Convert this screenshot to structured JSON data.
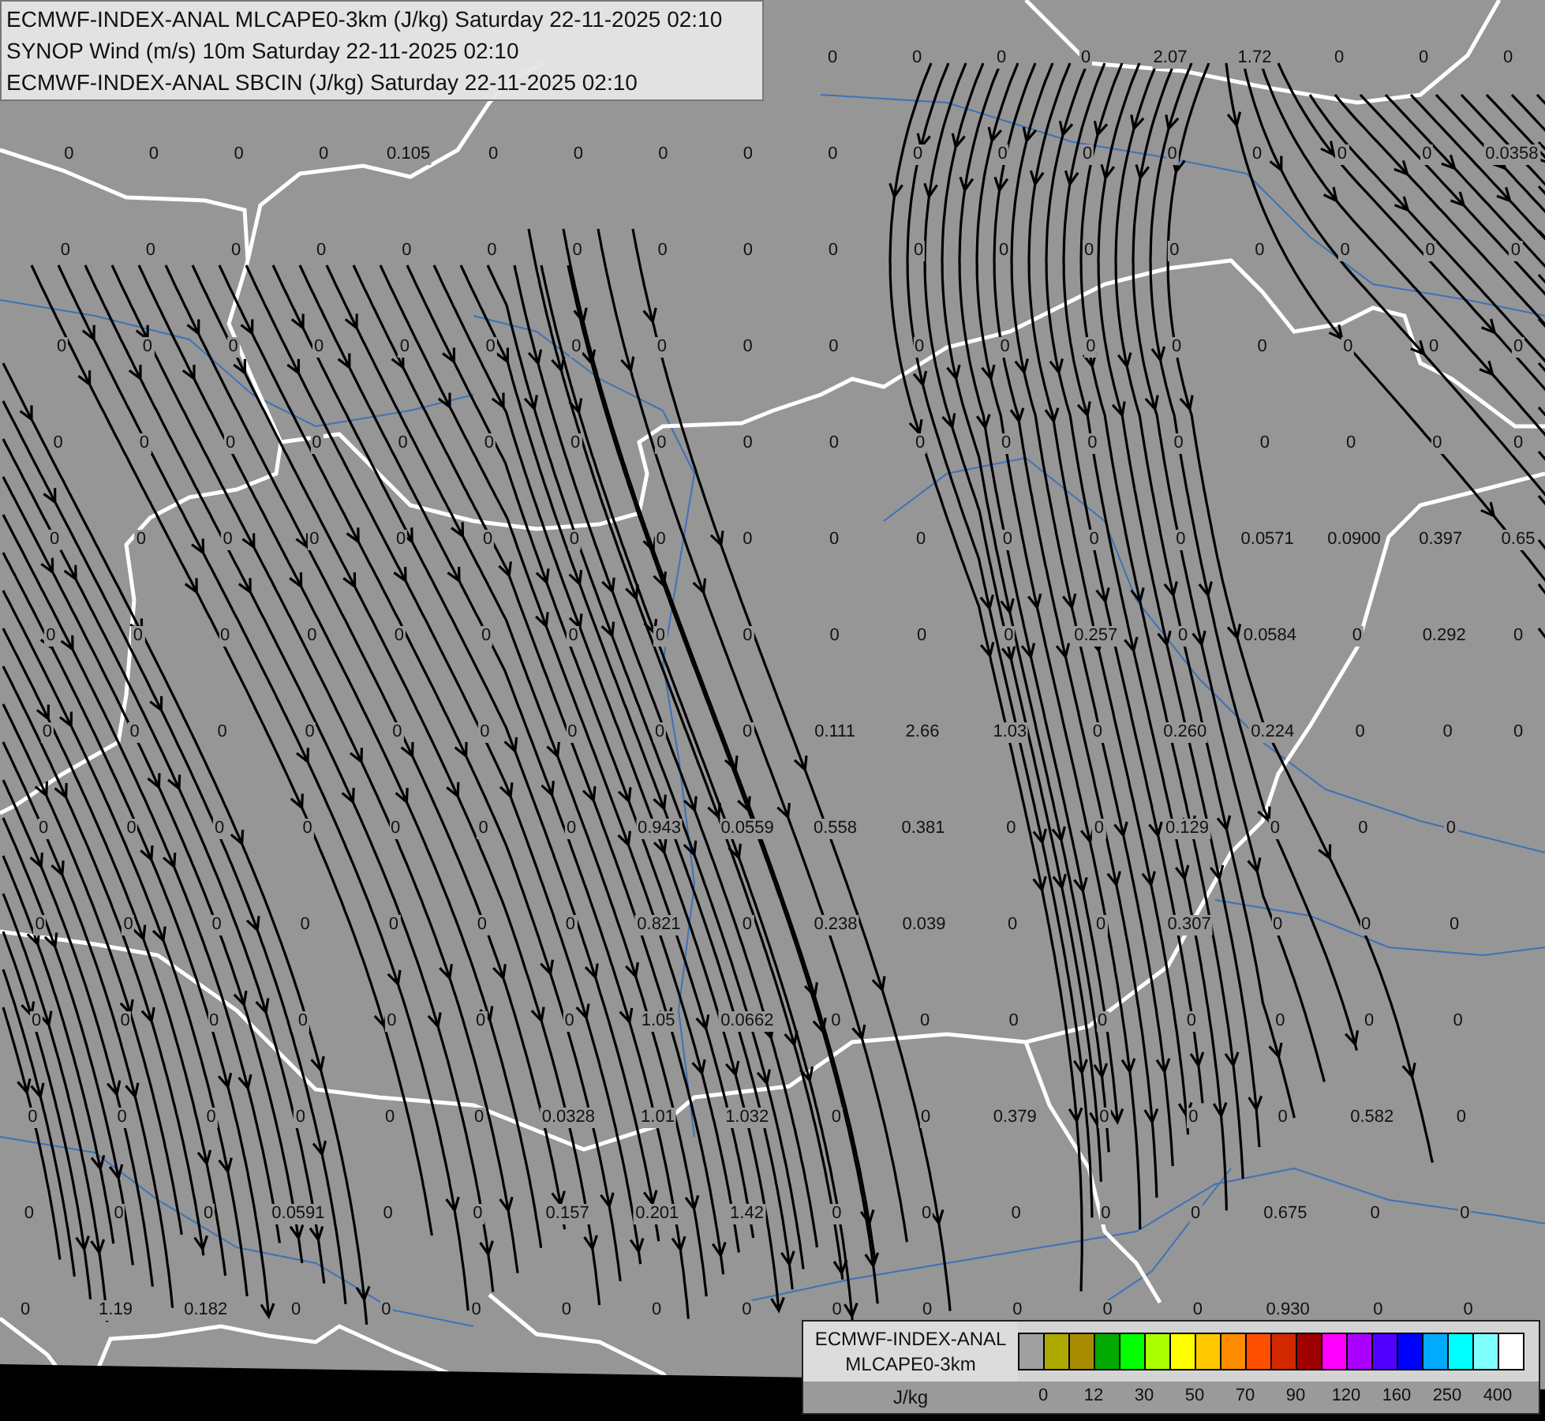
{
  "header": {
    "lines": [
      "ECMWF-INDEX-ANAL MLCAPE0-3km (J/kg) Saturday 22-11-2025 02:10",
      "SYNOP Wind (m/s) 10m Saturday 22-11-2025 02:10",
      "ECMWF-INDEX-ANAL SBCIN (J/kg) Saturday 22-11-2025 02:10"
    ]
  },
  "map": {
    "grid_rows": [
      {
        "kind": "trailing",
        "values": [
          "0",
          "0",
          "0",
          "0",
          "2.07",
          "1.72",
          "0",
          "0",
          "0"
        ]
      },
      {
        "kind": "full",
        "values": [
          "0",
          "0",
          "0",
          "0",
          "0.105",
          "0",
          "0",
          "0",
          "0",
          "0",
          "0",
          "0",
          "0",
          "0",
          "0",
          "0",
          "0",
          "0.0358"
        ]
      },
      {
        "kind": "full",
        "values": [
          "0",
          "0",
          "0",
          "0",
          "0",
          "0",
          "0",
          "0",
          "0",
          "0",
          "0",
          "0",
          "0",
          "0",
          "0",
          "0",
          "0",
          "0"
        ]
      },
      {
        "kind": "full",
        "values": [
          "0",
          "0",
          "0",
          "0",
          "0",
          "0",
          "0",
          "0",
          "0",
          "0",
          "0",
          "0",
          "0",
          "0",
          "0",
          "0",
          "0",
          "0"
        ]
      },
      {
        "kind": "full",
        "values": [
          "0",
          "0",
          "0",
          "0",
          "0",
          "0",
          "0",
          "0",
          "0",
          "0",
          "0",
          "0",
          "0",
          "0",
          "0",
          "0",
          "0",
          "0"
        ]
      },
      {
        "kind": "full",
        "values": [
          "0",
          "0",
          "0",
          "0",
          "0",
          "0",
          "0",
          "0",
          "0",
          "0",
          "0",
          "0",
          "0",
          "0",
          "0.0571",
          "0.0900",
          "0.397",
          "0.65"
        ]
      },
      {
        "kind": "full",
        "values": [
          "0",
          "0",
          "0",
          "0",
          "0",
          "0",
          "0",
          "0",
          "0",
          "0",
          "0",
          "0",
          "0.257",
          "0",
          "0.0584",
          "0",
          "0.292",
          "0"
        ]
      },
      {
        "kind": "full",
        "values": [
          "0",
          "0",
          "0",
          "0",
          "0",
          "0",
          "0",
          "0",
          "0",
          "0.111",
          "2.66",
          "1.03",
          "0",
          "0.260",
          "0.224",
          "0",
          "0",
          "0"
        ]
      },
      {
        "kind": "full",
        "values": [
          "0",
          "0",
          "0",
          "0",
          "0",
          "0",
          "0",
          "0.943",
          "0.0559",
          "0.558",
          "0.381",
          "0",
          "0",
          "0.129",
          "0",
          "0",
          "0"
        ]
      },
      {
        "kind": "full",
        "values": [
          "0",
          "0",
          "0",
          "0",
          "0",
          "0",
          "0",
          "0.821",
          "0",
          "0.238",
          "0.039",
          "0",
          "0",
          "0.307",
          "0",
          "0",
          "0"
        ]
      },
      {
        "kind": "full",
        "values": [
          "0",
          "0",
          "0",
          "0",
          "0",
          "0",
          "0",
          "1.05",
          "0.0662",
          "0",
          "0",
          "0",
          "0",
          "0",
          "0",
          "0",
          "0"
        ]
      },
      {
        "kind": "full",
        "values": [
          "0",
          "0",
          "0",
          "0",
          "0",
          "0",
          "0.0328",
          "1.01",
          "1.032",
          "0",
          "0",
          "0.379",
          "0",
          "0",
          "0",
          "0.582",
          "0"
        ]
      },
      {
        "kind": "full",
        "values": [
          "0",
          "0",
          "0",
          "0.0591",
          "0",
          "0",
          "0.157",
          "0.201",
          "1.42",
          "0",
          "0",
          "0",
          "0",
          "0",
          "0.675",
          "0",
          "0"
        ]
      },
      {
        "kind": "full",
        "values": [
          "0",
          "1.19",
          "0.182",
          "0",
          "0",
          "0",
          "0",
          "0",
          "0",
          "0",
          "0",
          "0",
          "0",
          "0",
          "0.930",
          "0",
          "0"
        ]
      }
    ]
  },
  "legend": {
    "title_lines": [
      "ECMWF-INDEX-ANAL",
      "MLCAPE0-3km"
    ],
    "unit": "J/kg",
    "swatches": [
      {
        "color": "#a0a0a0"
      },
      {
        "color": "#aca800"
      },
      {
        "color": "#a88c00"
      },
      {
        "color": "#00aa00"
      },
      {
        "color": "#00ff00"
      },
      {
        "color": "#aaff00"
      },
      {
        "color": "#ffff00"
      },
      {
        "color": "#ffc800"
      },
      {
        "color": "#ff8c00"
      },
      {
        "color": "#ff5000"
      },
      {
        "color": "#d22800"
      },
      {
        "color": "#a00000"
      },
      {
        "color": "#ff00ff"
      },
      {
        "color": "#aa00ff"
      },
      {
        "color": "#5000ff"
      },
      {
        "color": "#0000ff"
      },
      {
        "color": "#00aaff"
      },
      {
        "color": "#00ffff"
      },
      {
        "color": "#80ffff"
      },
      {
        "color": "#ffffff"
      }
    ],
    "tick_labels": [
      "0",
      "12",
      "30",
      "50",
      "70",
      "90",
      "120",
      "160",
      "250",
      "400"
    ]
  }
}
